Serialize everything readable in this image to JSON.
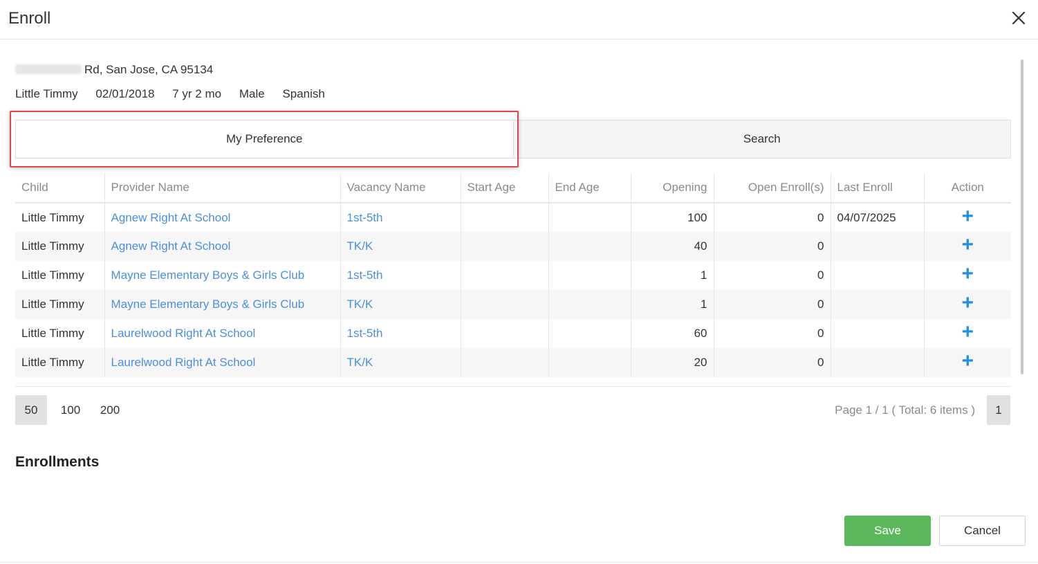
{
  "dialog": {
    "title": "Enroll",
    "close_icon": "close-icon"
  },
  "child_info": {
    "address": "Rd, San Jose, CA 95134",
    "name": "Little Timmy",
    "birthdate": "02/01/2018",
    "age": "7 yr 2 mo",
    "gender": "Male",
    "language": "Spanish"
  },
  "tabs": [
    {
      "label": "My Preference",
      "active": true
    },
    {
      "label": "Search",
      "active": false
    }
  ],
  "table": {
    "headers": [
      "Child",
      "Provider Name",
      "Vacancy Name",
      "Start Age",
      "End Age",
      "Opening",
      "Open Enroll(s)",
      "Last Enroll",
      "Action"
    ],
    "rows": [
      {
        "child": "Little Timmy",
        "provider": "Agnew Right At School",
        "vacancy": "1st-5th",
        "start_age": "",
        "end_age": "",
        "opening": "100",
        "open_enrolls": "0",
        "last_enroll": "04/07/2025",
        "action": "+"
      },
      {
        "child": "Little Timmy",
        "provider": "Agnew Right At School",
        "vacancy": "TK/K",
        "start_age": "",
        "end_age": "",
        "opening": "40",
        "open_enrolls": "0",
        "last_enroll": "",
        "action": "+"
      },
      {
        "child": "Little Timmy",
        "provider": "Mayne Elementary Boys & Girls Club",
        "vacancy": "1st-5th",
        "start_age": "",
        "end_age": "",
        "opening": "1",
        "open_enrolls": "0",
        "last_enroll": "",
        "action": "+"
      },
      {
        "child": "Little Timmy",
        "provider": "Mayne Elementary Boys & Girls Club",
        "vacancy": "TK/K",
        "start_age": "",
        "end_age": "",
        "opening": "1",
        "open_enrolls": "0",
        "last_enroll": "",
        "action": "+"
      },
      {
        "child": "Little Timmy",
        "provider": "Laurelwood Right At School",
        "vacancy": "1st-5th",
        "start_age": "",
        "end_age": "",
        "opening": "60",
        "open_enrolls": "0",
        "last_enroll": "",
        "action": "+"
      },
      {
        "child": "Little Timmy",
        "provider": "Laurelwood Right At School",
        "vacancy": "TK/K",
        "start_age": "",
        "end_age": "",
        "opening": "20",
        "open_enrolls": "0",
        "last_enroll": "",
        "action": "+"
      }
    ]
  },
  "pagination": {
    "page_sizes": [
      "50",
      "100",
      "200"
    ],
    "selected_page_size": "50",
    "page_info": "Page 1 / 1 ( Total: 6 items )",
    "current_page": "1"
  },
  "enrollments": {
    "heading": "Enrollments"
  },
  "footer": {
    "save_label": "Save",
    "cancel_label": "Cancel"
  },
  "colors": {
    "link": "#4b8fde",
    "action_plus": "#1f8fe8",
    "save_button": "#5cb85c",
    "highlight_border": "#e0474c"
  }
}
